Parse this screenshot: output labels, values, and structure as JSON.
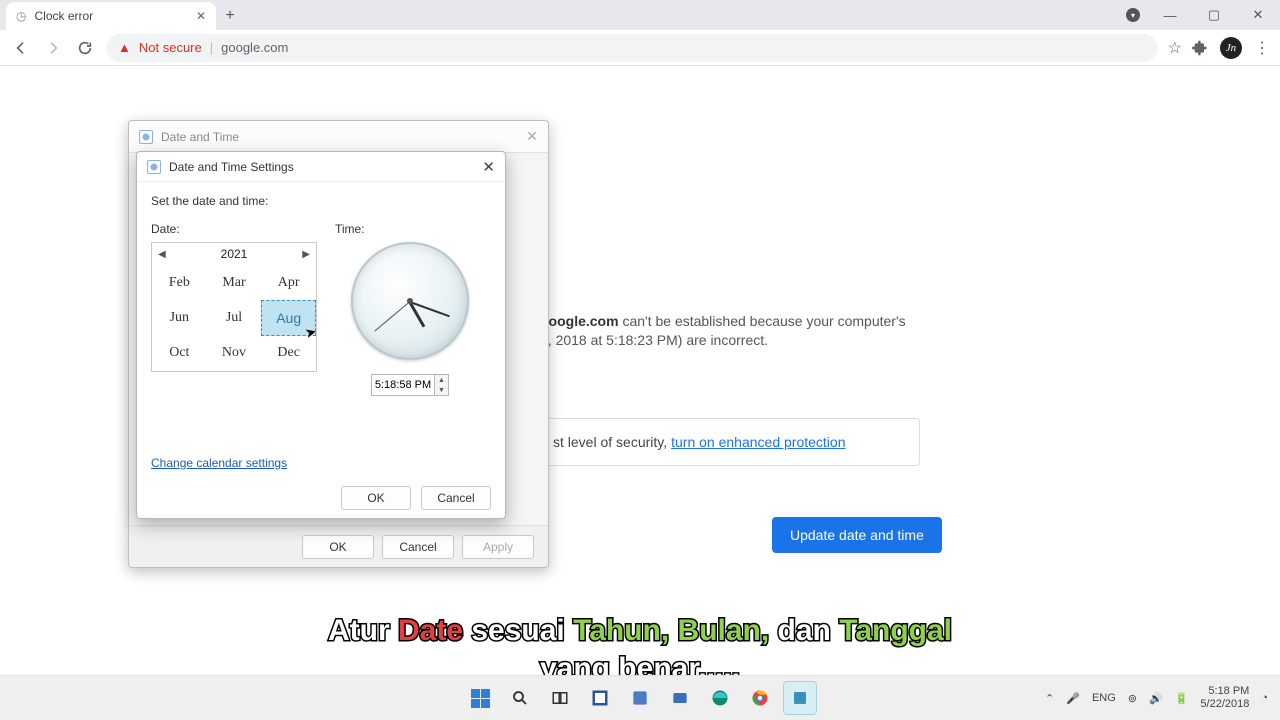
{
  "browser": {
    "tab_title": "Clock error",
    "not_secure": "Not secure",
    "url": "google.com"
  },
  "page": {
    "host": "google.com",
    "err_line1_suffix": " can't be established because your computer's",
    "err_line2": "2, 2018 at 5:18:23 PM) are incorrect.",
    "enhanced_prefix": "st level of security, ",
    "enhanced_link": "turn on enhanced protection",
    "update_btn": "Update date and time"
  },
  "dlg1": {
    "title": "Date and Time",
    "ok": "OK",
    "cancel": "Cancel",
    "apply": "Apply"
  },
  "dlg2": {
    "title": "Date and Time Settings",
    "set_label": "Set the date and time:",
    "date_label": "Date:",
    "time_label": "Time:",
    "year": "2021",
    "months": {
      "feb": "Feb",
      "mar": "Mar",
      "apr": "Apr",
      "jun": "Jun",
      "jul": "Jul",
      "aug": "Aug",
      "oct": "Oct",
      "nov": "Nov",
      "dec": "Dec"
    },
    "time_value": "5:18:58 PM",
    "change_cal": "Change calendar settings",
    "ok": "OK",
    "cancel": "Cancel"
  },
  "subs": {
    "atur": "Atur ",
    "date": "Date",
    "sesuai": " sesuai ",
    "tahun": "Tahun,",
    "bulan": " Bulan,",
    "dan": " dan ",
    "tanggal": "Tanggal",
    "line2": "yang benar....."
  },
  "taskbar": {
    "lang": "ENG",
    "time": "5:18 PM",
    "date": "5/22/2018"
  }
}
